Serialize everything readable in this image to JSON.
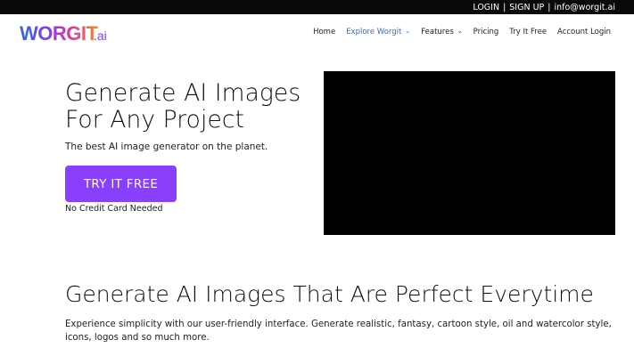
{
  "topbar": {
    "login": "LOGIN",
    "separator": "|",
    "signup": "SIGN UP",
    "email": "info@worgit.ai"
  },
  "logo": {
    "brand": "WORGIT",
    "suffix": ".ai",
    "colors": [
      "#2f6fe0",
      "#7b3ff2",
      "#e0389a",
      "#f08a2c"
    ]
  },
  "nav": {
    "items": [
      {
        "label": "Home"
      },
      {
        "label": "Explore Worgit",
        "dropdown": true,
        "active": true
      },
      {
        "label": "Features",
        "dropdown": true
      },
      {
        "label": "Pricing"
      },
      {
        "label": "Try It Free"
      },
      {
        "label": "Account Login"
      }
    ],
    "active_color": "#2a6fd6"
  },
  "hero": {
    "title_line1": "Generate AI Images",
    "title_line2": "For Any Project",
    "subtitle": "The best AI image generator on the planet.",
    "cta_label": "TRY IT FREE",
    "cta_color": "#8a3ffc",
    "cta_note": "No Credit Card Needed"
  },
  "section": {
    "title": "Generate AI Images That Are Perfect Everytime",
    "text": "Experience simplicity with our user-friendly interface. Generate realistic, fantasy, cartoon style, oil and watercolor style, icons, logos and so much more."
  }
}
